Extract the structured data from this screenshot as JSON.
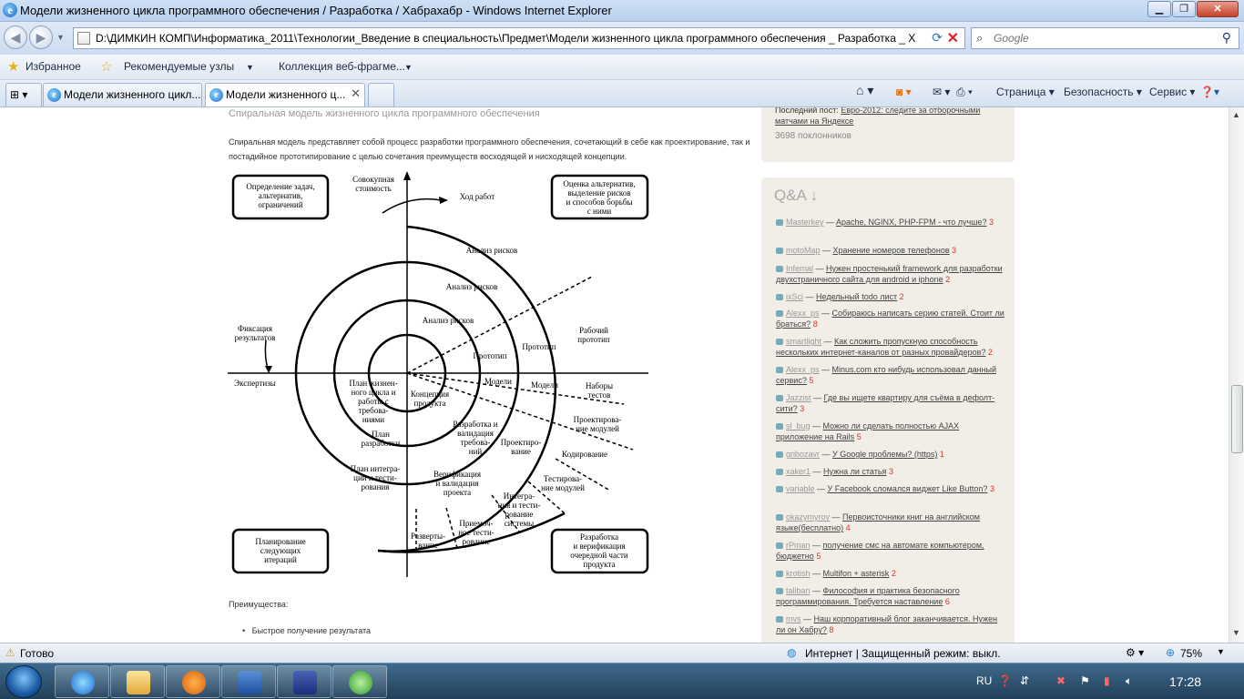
{
  "window": {
    "title": "Модели жизненного цикла программного обеспечения / Разработка / Хабрахабр - Windows Internet Explorer",
    "min": "▁",
    "max": "❐",
    "close": "✕"
  },
  "address": {
    "url": "D:\\ДИМКИН КОМП\\Информатика_2011\\Технологии_Введение в специальность\\Предмет\\Модели жизненного цикла программного обеспечения _ Разработка _ Хаб",
    "search_placeholder": "Google"
  },
  "favorites": {
    "favorites": "Избранное",
    "suggested": "Рекомендуемые узлы",
    "gallery": "Коллекция веб-фрагме..."
  },
  "tabs": [
    {
      "label": "Модели жизненного цикл..."
    },
    {
      "label": "Модели жизненного ц..."
    }
  ],
  "commands": {
    "page": "Страница",
    "safety": "Безопасность",
    "tools": "Сервис"
  },
  "article": {
    "heading": "Спиральная модель жизненного цикла программного обеспечения",
    "paragraph": "Спиральная модель представляет собой процесс разработки программного обеспечения, сочетающий в себе как проектирование, так и постадийное прототипирование с целью сочетания преимуществ восходящей и нисходящей концепции.",
    "advantages_title": "Преимущества:",
    "advantage_1": "Быстрое получение результата"
  },
  "diagram": {
    "box_tl": [
      "Определение задач,",
      "альтернатив,",
      "ограничений"
    ],
    "box_tr": [
      "Оценка альтернатив,",
      "выделение рисков",
      "и способов борьбы",
      "с ними"
    ],
    "box_bl": [
      "Планирование",
      "следующих",
      "итераций"
    ],
    "box_br": [
      "Разработка",
      "и верификация",
      "очередной части",
      "продукта"
    ],
    "cost": [
      "Совокупная",
      "стоимость"
    ],
    "progress": "Ход работ",
    "fix": [
      "Фиксация",
      "результатов"
    ],
    "review": "Экспертизы",
    "risk1": "Анализ рисков",
    "risk2": "Анализ рисков",
    "risk3": "Анализ рисков",
    "proto1": "Прототип",
    "proto2": "Прототип",
    "proto3": [
      "Рабочий",
      "прототип"
    ],
    "models1": "Модели",
    "models2": "Модели",
    "tests": [
      "Наборы",
      "тестов"
    ],
    "concept": [
      "Концепция",
      "продукта"
    ],
    "lifeplan": [
      "План жизнен-",
      "ного цикла и",
      "работы с",
      "требова-",
      "ниями"
    ],
    "devplan": [
      "План",
      "разработки"
    ],
    "intplan": [
      "План интегра-",
      "ции и тести-",
      "рования"
    ],
    "reqdev": [
      "Разработка и",
      "валидация",
      "требова-",
      "ний"
    ],
    "design": [
      "Проектиро-",
      "вание"
    ],
    "moddesign": [
      "Проектирова-",
      "ние модулей"
    ],
    "coding": "Кодирование",
    "modtest": [
      "Тестирова-",
      "ние модулей"
    ],
    "verif": [
      "Верификация",
      "и валидация",
      "проекта"
    ],
    "integ": [
      "Интегра-",
      "ция и тести-",
      "рование",
      "системы"
    ],
    "accept": [
      "Приемоч-",
      "ное тести-",
      "рование"
    ],
    "deploy": [
      "Разверты-",
      "вание"
    ]
  },
  "sidebar": {
    "last_post_label": "Последний пост:",
    "last_post_link": "Евро-2012: следите за отборочными матчами на Яндексе",
    "fans": "3698 поклонников",
    "qa_title": "Q&A ↓",
    "qa": [
      {
        "user": "Masterkey",
        "q": "Apache, NGINX, PHP-FPM - что лучше?",
        "n": "3"
      },
      {
        "user": "motoMap",
        "q": "Хранение номеров телефонов",
        "n": "3"
      },
      {
        "user": "Infernal",
        "q": "Нужен простенький framework для разработки двухстраничного сайта для android и iphone",
        "n": "2"
      },
      {
        "user": "ixSci",
        "q": "Недельный todo лист",
        "n": "2"
      },
      {
        "user": "Alexx_ps",
        "q": "Собираюсь написать серию статей. Стоит ли браться?",
        "n": "8"
      },
      {
        "user": "smartlight",
        "q": "Как сложить пропускную способность нескольких интернет-каналов от разных провайдеров?",
        "n": "2"
      },
      {
        "user": "Alexx_ps",
        "q": "Minus.com кто нибудь использовал данный сервис?",
        "n": "5"
      },
      {
        "user": "Jazzist",
        "q": "Где вы ищете квартиру для съёма в дефолт-сити?",
        "n": "3"
      },
      {
        "user": "sl_bug",
        "q": "Можно ли сделать полностью AJAX приложение на Rails",
        "n": "5"
      },
      {
        "user": "gribozavr",
        "q": "У Google проблемы? (https)",
        "n": "1"
      },
      {
        "user": "xaker1",
        "q": "Нужна ли статья",
        "n": "3"
      },
      {
        "user": "variable",
        "q": "У Facebook сломался виджет Like Button?",
        "n": "3"
      },
      {
        "user": "okazymyrov",
        "q": "Первоисточники книг на английском языке(бесплатно)",
        "n": "4"
      },
      {
        "user": "rPman",
        "q": "получение смс на автомате компьютером, бюджетно",
        "n": "5"
      },
      {
        "user": "krotish",
        "q": "Multifon + asterisk",
        "n": "2"
      },
      {
        "user": "taliban",
        "q": "Философия и практика безопасного программирования. Требуется наставление",
        "n": "6"
      },
      {
        "user": "mvs",
        "q": "Наш корпоративный блог заканчивается. Нужен ли он Хабру?",
        "n": "8"
      }
    ]
  },
  "status": {
    "text": "Готово",
    "zone": "Интернет | Защищенный режим: выкл.",
    "zoom": "75%"
  },
  "taskbar": {
    "lang": "RU",
    "time": "17:28"
  }
}
